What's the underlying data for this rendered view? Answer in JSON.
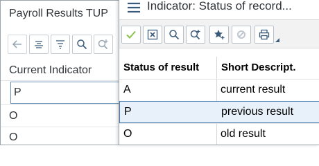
{
  "background": {
    "title": "Payroll Results TUP",
    "toolbar": [
      "back-arrow-icon",
      "align-center-icon",
      "filter-icon",
      "search-icon",
      "search-plus-icon"
    ],
    "column_header": "Current Indicator",
    "rows": [
      "P",
      "O",
      "O"
    ],
    "selected_index": 0
  },
  "dialog": {
    "title": "Indicator: Status of record...",
    "toolbar": [
      "check-icon",
      "close-box-icon",
      "search-icon",
      "search-plus-icon",
      "star-plus-icon",
      "settings-link-icon",
      "print-icon"
    ],
    "columns": [
      "Status of result",
      "Short Descript."
    ],
    "rows": [
      {
        "status": "A",
        "desc": "current result"
      },
      {
        "status": "P",
        "desc": "previous result"
      },
      {
        "status": "O",
        "desc": "old result"
      }
    ],
    "selected_index": 1
  },
  "colors": {
    "selected_row_bg": "#e8f1fa",
    "selected_row_border": "#4a7fb5",
    "icon_blue": "#3a5a7a",
    "check_green": "#8bc34a"
  }
}
